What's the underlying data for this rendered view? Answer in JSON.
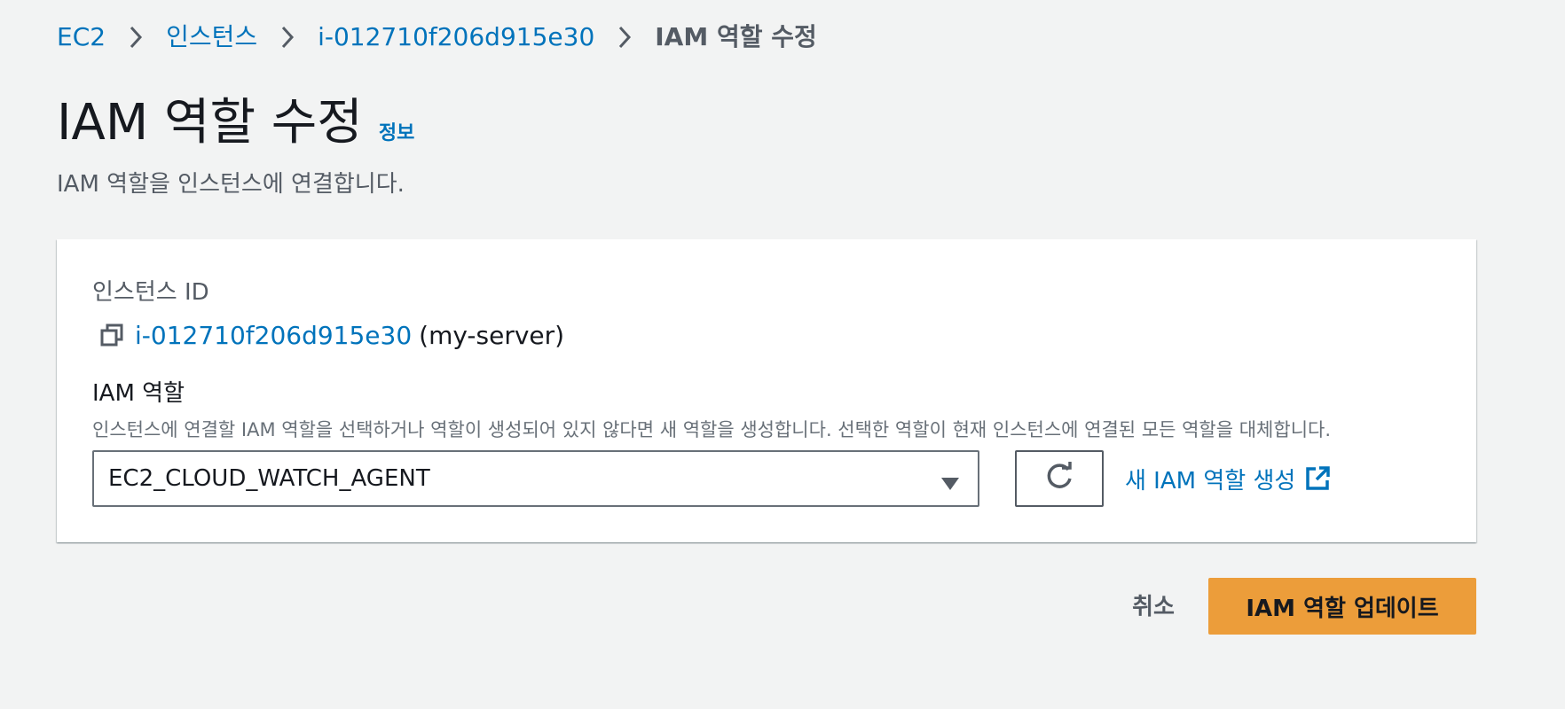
{
  "breadcrumb": {
    "items": [
      {
        "label": "EC2"
      },
      {
        "label": "인스턴스"
      },
      {
        "label": "i-012710f206d915e30"
      }
    ],
    "current": "IAM 역할 수정"
  },
  "page": {
    "title": "IAM 역할 수정",
    "info_link": "정보",
    "description": "IAM 역할을 인스턴스에 연결합니다."
  },
  "form": {
    "instance_id_label": "인스턴스 ID",
    "instance_id": "i-012710f206d915e30",
    "instance_name": "(my-server)",
    "role_label": "IAM 역할",
    "role_description": "인스턴스에 연결할 IAM 역할을 선택하거나 역할이 생성되어 있지 않다면 새 역할을 생성합니다. 선택한 역할이 현재 인스턴스에 연결된 모든 역할을 대체합니다.",
    "role_selected": "EC2_CLOUD_WATCH_AGENT",
    "create_role_link": "새 IAM 역할 생성"
  },
  "actions": {
    "cancel": "취소",
    "submit": "IAM 역할 업데이트"
  },
  "icons": {
    "chevron": "chevron-right-icon",
    "copy": "copy-icon",
    "caret": "caret-down-icon",
    "refresh": "refresh-icon",
    "external": "external-link-icon"
  },
  "colors": {
    "link": "#0073bb",
    "primary_button": "#ec9d3a",
    "background": "#f2f3f3"
  }
}
